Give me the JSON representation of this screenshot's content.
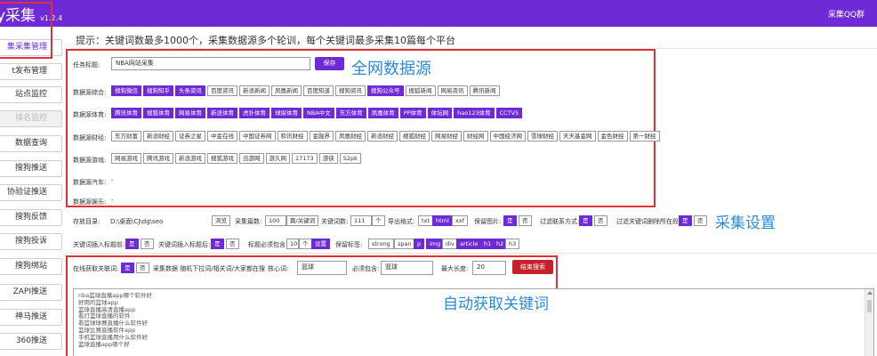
{
  "app": {
    "title": "y采集",
    "version": "v1.2.4",
    "top_right": "采集QQ群"
  },
  "sidebar": {
    "items": [
      {
        "label": "集采集管理",
        "state": "active"
      },
      {
        "label": "t发布管理",
        "state": "normal"
      },
      {
        "label": "站点监控",
        "state": "normal"
      },
      {
        "label": "排名监控",
        "state": "disabled"
      },
      {
        "label": "数据查询",
        "state": "normal"
      },
      {
        "label": "搜狗推送",
        "state": "normal"
      },
      {
        "label": "协验证推送",
        "state": "normal"
      },
      {
        "label": "搜狗反馈",
        "state": "normal"
      },
      {
        "label": "搜狗投诉",
        "state": "normal"
      },
      {
        "label": "搜狗绑站",
        "state": "normal"
      },
      {
        "label": "ZAPI推送",
        "state": "normal"
      },
      {
        "label": "神马推送",
        "state": "normal"
      },
      {
        "label": "360推送",
        "state": "normal"
      }
    ]
  },
  "tip": "提示：关键词数最多1000个，采集数据源多个轮训，每个关键词最多采集10篇每个平台",
  "task": {
    "label": "任务标题:",
    "value": "NBA网站采集",
    "save": "保存"
  },
  "annotations": {
    "all_sources": "全网数据源",
    "settings": "采集设置",
    "auto_keywords": "自动获取关键词"
  },
  "sources": [
    {
      "label": "数据源综合:",
      "tags": [
        {
          "t": "搜狗微信",
          "on": true
        },
        {
          "t": "搜狗知乎",
          "on": true
        },
        {
          "t": "头条资讯",
          "on": true
        },
        {
          "t": "百度资讯",
          "on": false
        },
        {
          "t": "新浪新闻",
          "on": false
        },
        {
          "t": "凤凰新闻",
          "on": false
        },
        {
          "t": "百度知道",
          "on": false
        },
        {
          "t": "搜狗资讯",
          "on": false
        },
        {
          "t": "搜狗公众号",
          "on": true
        },
        {
          "t": "搜狐新闻",
          "on": false
        },
        {
          "t": "网易资讯",
          "on": false
        },
        {
          "t": "腾讯新闻",
          "on": false
        }
      ]
    },
    {
      "label": "数据源体育:",
      "tags": [
        {
          "t": "腾讯体育",
          "on": true
        },
        {
          "t": "搜狐体育",
          "on": true
        },
        {
          "t": "网易体育",
          "on": true
        },
        {
          "t": "新浪体育",
          "on": true
        },
        {
          "t": "虎扑体育",
          "on": true
        },
        {
          "t": "球探体育",
          "on": true
        },
        {
          "t": "NBA中文",
          "on": true
        },
        {
          "t": "东方体育",
          "on": true
        },
        {
          "t": "凤凰体育",
          "on": true
        },
        {
          "t": "PP体育",
          "on": true
        },
        {
          "t": "体坛网",
          "on": true
        },
        {
          "t": "hao123体育",
          "on": true
        },
        {
          "t": "CCTV5",
          "on": true
        }
      ]
    },
    {
      "label": "数据源财经:",
      "tags": [
        {
          "t": "东方财富",
          "on": false
        },
        {
          "t": "新浪财经",
          "on": false
        },
        {
          "t": "证券之星",
          "on": false
        },
        {
          "t": "中金在线",
          "on": false
        },
        {
          "t": "中国证券网",
          "on": false
        },
        {
          "t": "和讯财经",
          "on": false
        },
        {
          "t": "金融界",
          "on": false
        },
        {
          "t": "凤凰财经",
          "on": false
        },
        {
          "t": "新浪财经",
          "on": false
        },
        {
          "t": "搜狐财经",
          "on": false
        },
        {
          "t": "网易财经",
          "on": false
        },
        {
          "t": "财经网",
          "on": false
        },
        {
          "t": "中国经济网",
          "on": false
        },
        {
          "t": "雪球财经",
          "on": false
        },
        {
          "t": "天天基金网",
          "on": false
        },
        {
          "t": "金色财经",
          "on": false
        },
        {
          "t": "第一财经",
          "on": false
        }
      ]
    },
    {
      "label": "数据源游戏:",
      "tags": [
        {
          "t": "网易游戏",
          "on": false
        },
        {
          "t": "腾讯游戏",
          "on": false
        },
        {
          "t": "新浪游戏",
          "on": false
        },
        {
          "t": "搜狐游戏",
          "on": false
        },
        {
          "t": "迅游网",
          "on": false
        },
        {
          "t": "游久网",
          "on": false
        },
        {
          "t": "17173",
          "on": false
        },
        {
          "t": "游侠",
          "on": false
        },
        {
          "t": "52pk",
          "on": false
        }
      ]
    },
    {
      "label": "数据源汽车:",
      "tags": [],
      "placeholder": "-"
    },
    {
      "label": "数据源娱乐:",
      "tags": [],
      "placeholder": "-"
    }
  ],
  "settings": {
    "storage_label": "存放目录:",
    "storage_path": "D:\\桌面\\CJ\\dg\\seo",
    "browse": "浏览",
    "count_label": "采集篇数:",
    "count_value": "100",
    "count_unit": "篇/关键词",
    "kw_label": "关键词数:",
    "kw_value": "111",
    "kw_unit": "个",
    "export_label": "导出格式:",
    "export": [
      {
        "t": "txt",
        "on": false
      },
      {
        "t": "html",
        "on": true
      },
      {
        "t": "xxf",
        "on": false
      }
    ],
    "keep_img_label": "保留图片:",
    "keep_img": [
      {
        "t": "是",
        "on": true
      },
      {
        "t": "否",
        "on": false
      }
    ],
    "filter_contact_label": "过滤联系方式:",
    "filter_contact": [
      {
        "t": "是",
        "on": true
      },
      {
        "t": "否",
        "on": false
      }
    ],
    "filter_kw_label": "过滤关键词删除所在段:",
    "filter_kw": [
      {
        "t": "是",
        "on": true
      },
      {
        "t": "否",
        "on": false
      }
    ],
    "insert_title_label": "关键词插入标题前:",
    "insert_title": [
      {
        "t": "是",
        "on": true
      },
      {
        "t": "否",
        "on": false
      }
    ],
    "insert_after_label": "关键词插入标题后:",
    "insert_after": [
      {
        "t": "是",
        "on": true
      },
      {
        "t": "否",
        "on": false
      }
    ],
    "title_must_label": "标题必须包含:",
    "title_must_value": "10",
    "title_must_unit": "个",
    "title_must_btn": "设置",
    "keep_tags_label": "保留标签:",
    "keep_tags": [
      {
        "t": "strong",
        "on": false
      },
      {
        "t": "span",
        "on": false
      },
      {
        "t": "p",
        "on": true
      },
      {
        "t": "img",
        "on": true
      },
      {
        "t": "div",
        "on": false
      },
      {
        "t": "article",
        "on": true
      },
      {
        "t": "h1",
        "on": true
      },
      {
        "t": "h2",
        "on": true
      },
      {
        "t": "h3",
        "on": false
      }
    ]
  },
  "autokw": {
    "online_label": "在线获取关联词:",
    "online": [
      {
        "t": "是",
        "on": true
      },
      {
        "t": "否",
        "on": false
      }
    ],
    "desc": "采集数据 随机下拉词/相关词/大家都在搜",
    "core_label": "核心词:",
    "core_value": "篮球",
    "must_label": "必须包含:",
    "must_value": "篮球",
    "maxlen_label": "最大长度:",
    "maxlen_value": "20",
    "search_btn": "结束搜索"
  },
  "keywords": [
    "nba篮球直播app哪个软件好",
    "好用的篮球app",
    "篮球直播高清直播app",
    "看打篮球直播的软件",
    "看篮球球赛直播什么软件好",
    "篮球比赛直播软件app",
    "手机篮球直播用什么软件好",
    "篮球直播app哪个好"
  ]
}
